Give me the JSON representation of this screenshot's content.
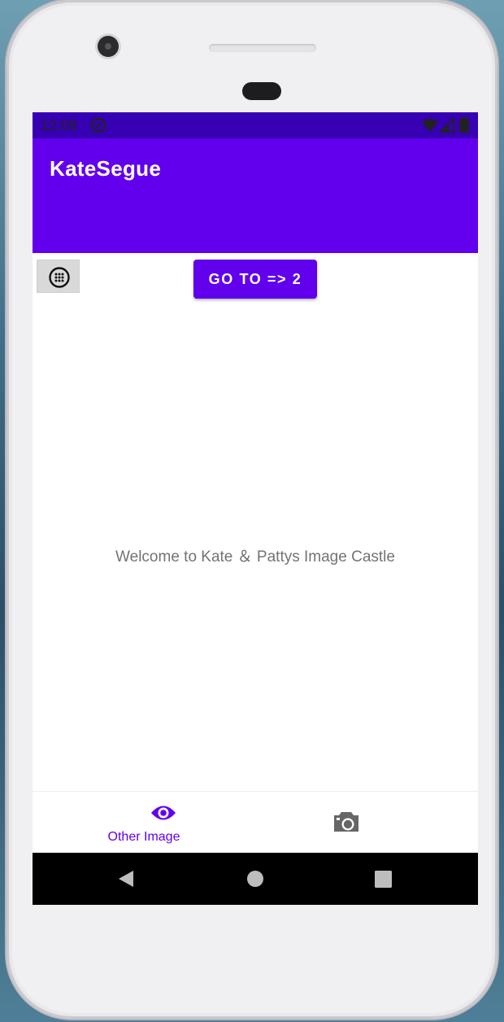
{
  "status_bar": {
    "time": "12:08"
  },
  "app_bar": {
    "title": "KateSegue"
  },
  "main": {
    "go_button_label": "GO TO => 2",
    "welcome_text": "Welcome to Kate ＆ Pattys Image Castle"
  },
  "bottom_nav": {
    "items": [
      {
        "label": "Other Image",
        "icon": "eye-icon",
        "active": true
      },
      {
        "label": "",
        "icon": "camera-icon",
        "active": false
      }
    ]
  },
  "colors": {
    "primary": "#6200ee",
    "primary_dark": "#3700b3",
    "text_secondary": "#737373"
  }
}
